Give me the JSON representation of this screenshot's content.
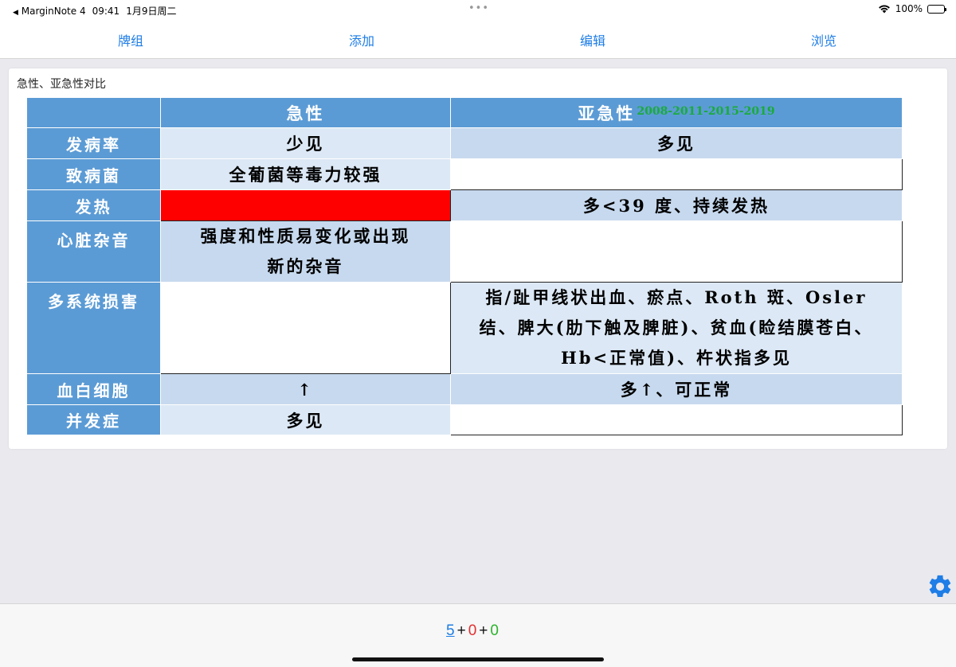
{
  "status_bar": {
    "back_app": "MarginNote 4",
    "time": "09:41",
    "date": "1月9日周二",
    "battery": "100%"
  },
  "toolbar": {
    "decks": "牌组",
    "add": "添加",
    "edit": "编辑",
    "browse": "浏览"
  },
  "card": {
    "title": "急性、亚急性对比",
    "table": {
      "header": {
        "acute": "急性",
        "subacute": "亚急性",
        "years": "2008-2011-2015-2019"
      },
      "rows": [
        {
          "label": "发病率",
          "acute": "少见",
          "subacute": "多见"
        },
        {
          "label": "致病菌",
          "acute": "全葡菌等毒力较强",
          "subacute": ""
        },
        {
          "label": "发热",
          "acute": "",
          "subacute": "多<39 度、持续发热"
        },
        {
          "label": "心脏杂音",
          "acute_line1": "强度和性质易变化或出现",
          "acute_line2": "新的杂音",
          "subacute": ""
        },
        {
          "label": "多系统损害",
          "acute": "",
          "subacute_line1": "指/趾甲线状出血、瘀点、Roth 斑、Osler",
          "subacute_line2": "结、脾大(肋下触及脾脏)、贫血(睑结膜苍白、",
          "subacute_line3": "Hb<正常值)、杵状指多见"
        },
        {
          "label": "血白细胞",
          "acute": "↑",
          "subacute": "多↑、可正常"
        },
        {
          "label": "并发症",
          "acute": "多见",
          "subacute": ""
        }
      ]
    }
  },
  "footer": {
    "new_count": "5",
    "learn_count": "0",
    "review_count": "0",
    "plus": "+"
  },
  "colors": {
    "accent": "#1e7de6",
    "table_header": "#5b9bd5",
    "cell_light": "#dce8f5",
    "cell_mid": "#c7d9ee",
    "cloze_red": "#ff0000",
    "years_green": "#1aab3a"
  }
}
